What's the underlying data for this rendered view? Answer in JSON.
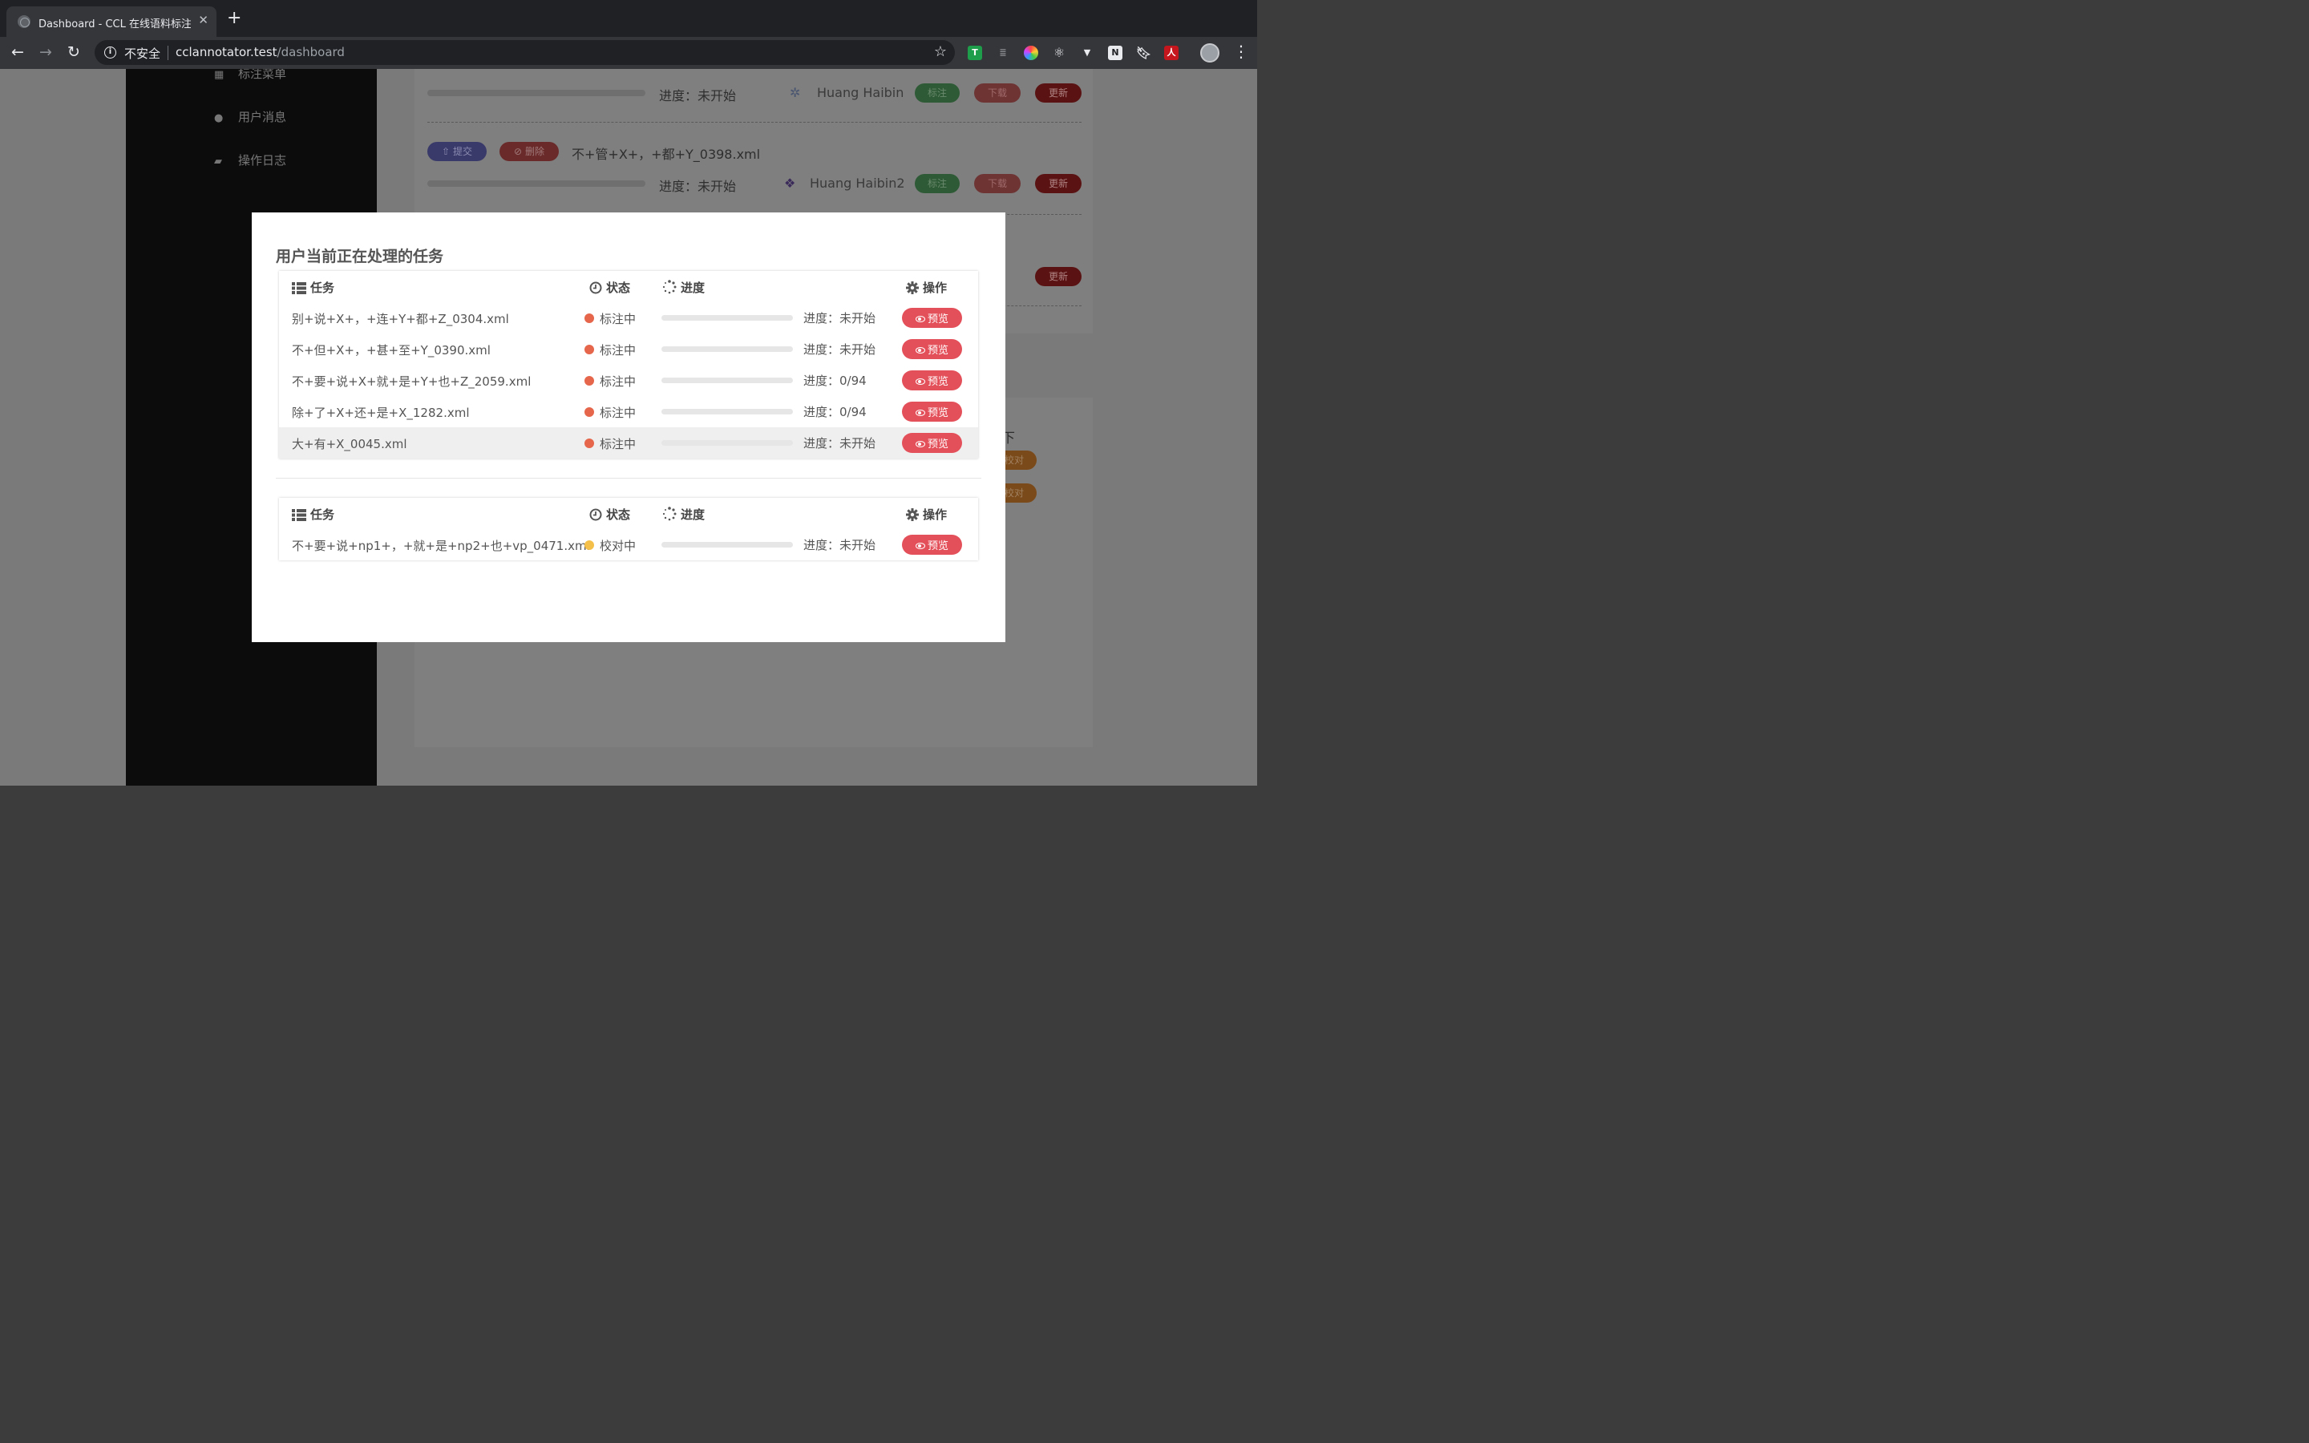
{
  "browser": {
    "tab_title": "Dashboard - CCL 在线语料标注",
    "tab_close": "✕",
    "new_tab": "+",
    "security_label": "不安全",
    "url_host": "cclannotator.test",
    "url_path": "/dashboard",
    "extensions": [
      "tampermonkey-icon",
      "reader-icon",
      "color-icon",
      "react-icon",
      "vue-icon",
      "notion-icon",
      "bookmark-icon",
      "pdf-icon"
    ]
  },
  "sidebar": {
    "items": [
      {
        "label": "标注菜单",
        "icon": "grid-icon"
      },
      {
        "label": "用户消息",
        "icon": "comment-icon"
      },
      {
        "label": "操作日志",
        "icon": "book-icon"
      }
    ]
  },
  "background_list": {
    "rows": [
      {
        "progress_text": "进度：未开始",
        "user": "Huang Haibin",
        "actions": [
          "标注",
          "下载",
          "更新"
        ]
      },
      {
        "submit": "提交",
        "delete": "删除",
        "file": "不+管+X+，+都+Y_0398.xml",
        "progress_text": "进度：未开始",
        "user": "Huang Haibin2",
        "actions": [
          "标注",
          "下载",
          "更新"
        ]
      },
      {
        "actions": [
          "更新"
        ]
      }
    ],
    "card2_fragments": {
      "heading_char": "下",
      "btn1": "校对",
      "btn2": "校对"
    }
  },
  "modal": {
    "title": "用户当前正在处理的任务",
    "columns": {
      "task": "任务",
      "status": "状态",
      "progress": "进度",
      "action": "操作"
    },
    "table1": [
      {
        "name": "别+说+X+，+连+Y+都+Z_0304.xml",
        "status": "标注中",
        "status_color": "#e5664b",
        "progress": "进度：未开始",
        "action": "预览"
      },
      {
        "name": "不+但+X+，+甚+至+Y_0390.xml",
        "status": "标注中",
        "status_color": "#e5664b",
        "progress": "进度：未开始",
        "action": "预览"
      },
      {
        "name": "不+要+说+X+就+是+Y+也+Z_2059.xml",
        "status": "标注中",
        "status_color": "#e5664b",
        "progress": "进度：0/94",
        "action": "预览"
      },
      {
        "name": "除+了+X+还+是+X_1282.xml",
        "status": "标注中",
        "status_color": "#e5664b",
        "progress": "进度：0/94",
        "action": "预览"
      },
      {
        "name": "大+有+X_0045.xml",
        "status": "标注中",
        "status_color": "#e5664b",
        "progress": "进度：未开始",
        "action": "预览"
      }
    ],
    "table2": [
      {
        "name": "不+要+说+np1+，+就+是+np2+也+vp_0471.xml",
        "status": "校对中",
        "status_color": "#f5c04a",
        "progress": "进度：未开始",
        "action": "预览"
      }
    ]
  }
}
